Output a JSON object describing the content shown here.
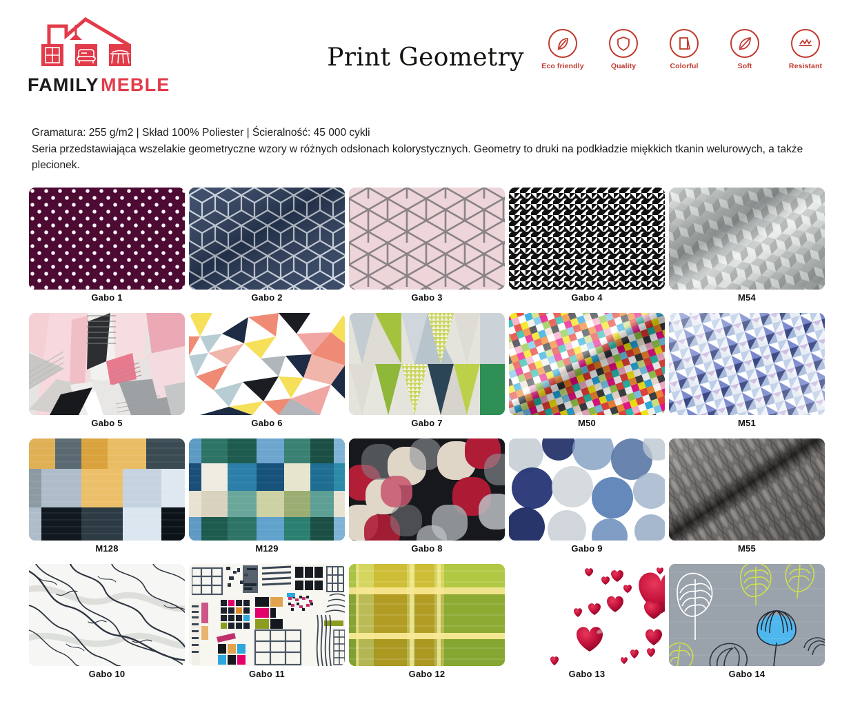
{
  "brand": {
    "name_part1": "FAMILY",
    "name_part2": "MEBLE",
    "logo_color": "#e23b4a",
    "text_dark": "#1b1b1b"
  },
  "header": {
    "title": "Print Geometry",
    "features": [
      {
        "icon": "leaf-icon",
        "label": "Eco friendly"
      },
      {
        "icon": "shield-icon",
        "label": "Quality"
      },
      {
        "icon": "colorful-icon",
        "label": "Colorful"
      },
      {
        "icon": "feather-icon",
        "label": "Soft"
      },
      {
        "icon": "abrasion-icon",
        "label": "Resistant"
      }
    ],
    "feature_color": "#c2392f"
  },
  "intro": {
    "specs": "Gramatura: 255 g/m2 | Skład 100% Poliester | Ścieralność: 45 000 cykli",
    "description": "Seria przedstawiająca wszelakie geometryczne wzory w różnych odsłonach kolorystycznych. Geometry to druki na podkładzie miękkich tkanin welurowych, a także plecionek."
  },
  "swatches": [
    {
      "label": "Gabo 1",
      "pattern": "p-gabo1",
      "desc": "maroon with white polka dots"
    },
    {
      "label": "Gabo 2",
      "pattern": "p-gabo2",
      "desc": "navy blue with silver cube outlines"
    },
    {
      "label": "Gabo 3",
      "pattern": "p-gabo3",
      "desc": "pale pink with grey geometric lines"
    },
    {
      "label": "Gabo 4",
      "pattern": "p-gabo4",
      "desc": "black and white houndstooth"
    },
    {
      "label": "M54",
      "pattern": "p-m54",
      "desc": "grey three dimensional cubes"
    },
    {
      "label": "Gabo 5",
      "pattern": "p-gabo5",
      "desc": "pink grey abstract geometric collage"
    },
    {
      "label": "Gabo 6",
      "pattern": "p-gabo6",
      "desc": "multicolour low poly triangles"
    },
    {
      "label": "Gabo 7",
      "pattern": "p-gabo7",
      "desc": "green and grey triangles"
    },
    {
      "label": "M50",
      "pattern": "p-m50",
      "desc": "rainbow pixel mosaic squares"
    },
    {
      "label": "M51",
      "pattern": "p-m51",
      "desc": "pale blue and violet triangles"
    },
    {
      "label": "M128",
      "pattern": "p-m128",
      "desc": "mustard navy and grey linen squares"
    },
    {
      "label": "M129",
      "pattern": "p-m129",
      "desc": "teal blue and cream linen squares"
    },
    {
      "label": "Gabo 8",
      "pattern": "p-gabo8",
      "desc": "black red grey rounded shapes"
    },
    {
      "label": "Gabo 9",
      "pattern": "p-gabo9",
      "desc": "blue watercolour circles"
    },
    {
      "label": "M55",
      "pattern": "p-m55",
      "desc": "grey quilted diamond texture"
    },
    {
      "label": "Gabo 10",
      "pattern": "p-gabo10",
      "desc": "white marble veining"
    },
    {
      "label": "Gabo 11",
      "pattern": "p-gabo11",
      "desc": "graphic collage blocks"
    },
    {
      "label": "Gabo 12",
      "pattern": "p-gabo12",
      "desc": "green and yellow plaid"
    },
    {
      "label": "Gabo 13",
      "pattern": "p-gabo13",
      "desc": "red hearts on white"
    },
    {
      "label": "Gabo 14",
      "pattern": "p-gabo14",
      "desc": "grey with outlined leaves"
    }
  ]
}
